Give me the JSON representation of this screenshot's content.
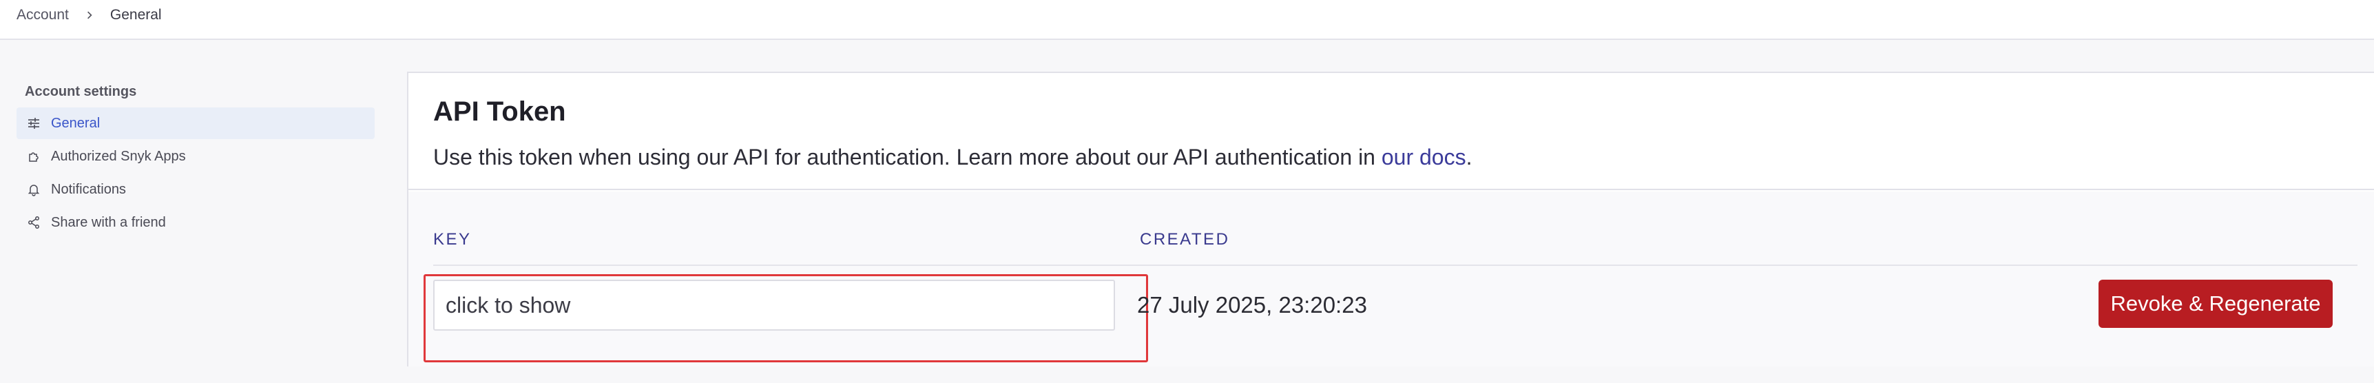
{
  "breadcrumb": {
    "items": [
      {
        "label": "Account"
      },
      {
        "label": "General"
      }
    ]
  },
  "sidebar": {
    "heading": "Account settings",
    "items": [
      {
        "label": "General",
        "icon": "sliders-icon",
        "active": true
      },
      {
        "label": "Authorized Snyk Apps",
        "icon": "puzzle-icon",
        "active": false
      },
      {
        "label": "Notifications",
        "icon": "bell-icon",
        "active": false
      },
      {
        "label": "Share with a friend",
        "icon": "share-icon",
        "active": false
      }
    ]
  },
  "api_token": {
    "title": "API Token",
    "description_prefix": "Use this token when using our API for authentication. Learn more about our API authentication in ",
    "docs_link": "our docs",
    "description_suffix": ".",
    "key_header": "KEY",
    "created_header": "CREATED",
    "key_placeholder": "click to show",
    "created_value": "27 July 2025, 23:20:23",
    "revoke_label": "Revoke & Regenerate"
  },
  "colors": {
    "accent": "#3a55c9",
    "danger": "#b81d22",
    "highlight": "#e0383b",
    "link": "#3b3b9a"
  }
}
